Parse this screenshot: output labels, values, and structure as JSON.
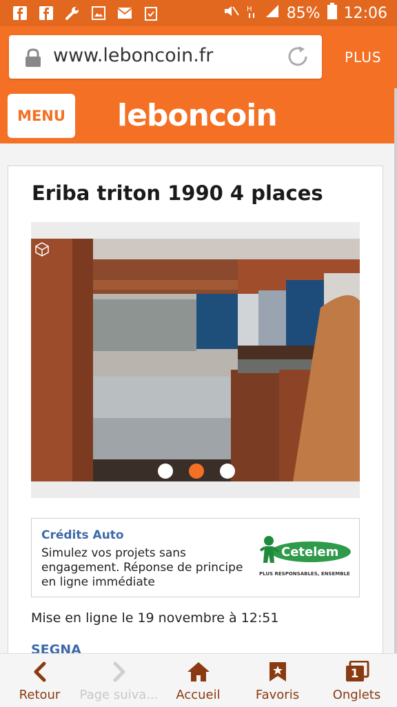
{
  "status_bar": {
    "left_icons": [
      "facebook-icon",
      "facebook-icon",
      "wrench-icon",
      "image-icon",
      "mail-icon",
      "clipboard-icon"
    ],
    "battery_percent": "85%",
    "time": "12:06"
  },
  "browser": {
    "url": "www.leboncoin.fr",
    "more_label": "PLUS"
  },
  "site": {
    "menu_label": "MENU",
    "logo_text": "leboncoin"
  },
  "listing": {
    "title": "Eriba triton 1990 4 places",
    "gallery": {
      "image_count": 3,
      "active_index": 1
    },
    "published": "Mise en ligne le 19 novembre à 12:51",
    "next_section_label": "SEGNA"
  },
  "ad": {
    "title": "Crédits Auto",
    "text": "Simulez vos projets sans engagement. Réponse de principe en ligne immédiate",
    "brand": "Cetelem",
    "tagline": "PLUS RESPONSABLES, ENSEMBLE"
  },
  "bottom_nav": [
    {
      "label": "Retour",
      "icon": "chevron-left-icon"
    },
    {
      "label": "Page suiva...",
      "icon": "chevron-right-icon"
    },
    {
      "label": "Accueil",
      "icon": "home-icon"
    },
    {
      "label": "Favoris",
      "icon": "bookmark-star-icon"
    },
    {
      "label": "Onglets",
      "icon": "tabs-icon",
      "badge": "1"
    }
  ],
  "colors": {
    "brand_orange": "#f37024",
    "status_orange": "#e2681f",
    "link_blue": "#3d6aa8",
    "nav_brown": "#8a3a10"
  }
}
